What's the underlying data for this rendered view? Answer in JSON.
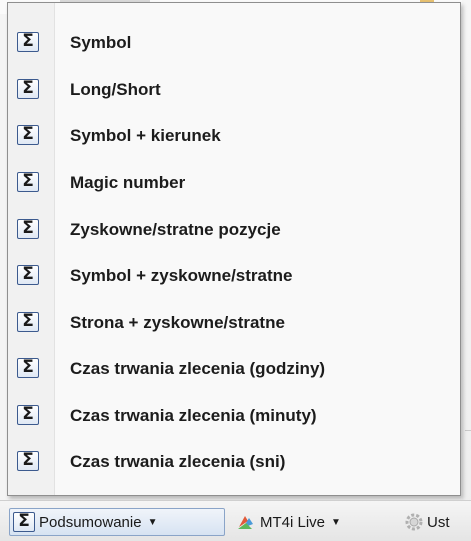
{
  "menu": {
    "items": [
      {
        "label": "Symbol",
        "icon": "sigma-icon"
      },
      {
        "label": "Long/Short",
        "icon": "sigma-icon"
      },
      {
        "label": "Symbol + kierunek",
        "icon": "sigma-icon"
      },
      {
        "label": "Magic number",
        "icon": "sigma-icon"
      },
      {
        "label": "Zyskowne/stratne pozycje",
        "icon": "sigma-icon"
      },
      {
        "label": "Symbol + zyskowne/stratne",
        "icon": "sigma-icon"
      },
      {
        "label": "Strona + zyskowne/stratne",
        "icon": "sigma-icon"
      },
      {
        "label": "Czas trwania zlecenia (godziny)",
        "icon": "sigma-icon"
      },
      {
        "label": "Czas trwania zlecenia (minuty)",
        "icon": "sigma-icon"
      },
      {
        "label": "Czas trwania zlecenia (sni)",
        "icon": "sigma-icon"
      }
    ]
  },
  "toolbar": {
    "summary_label": "Podsumowanie",
    "account_label": "MT4i Live",
    "settings_label": "Ust",
    "icons": {
      "summary": "sigma-icon",
      "account": "mt4i-logo-icon",
      "settings": "gear-icon"
    }
  },
  "colors": {
    "menu_bg": "#f9f9f9",
    "active_button": "#d7e3f2",
    "text": "#1c1c1c"
  }
}
